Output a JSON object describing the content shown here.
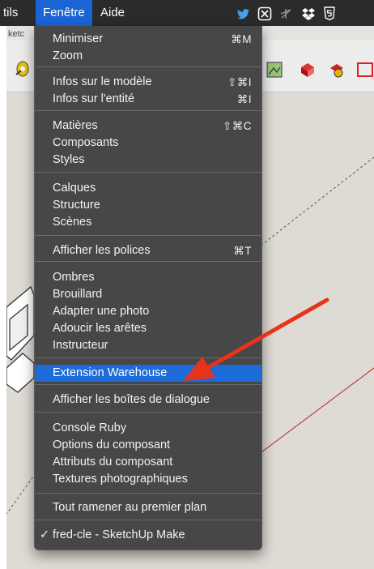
{
  "menubar": {
    "items": [
      "tils",
      "Fenêtre",
      "Aide"
    ],
    "active_index": 1,
    "icons": [
      "twitter-icon",
      "sketchup-extension-icon",
      "wifi-pin-icon",
      "dropbox-icon",
      "html5-icon"
    ]
  },
  "app": {
    "window_title_fragment": "ketc"
  },
  "menu": {
    "sections": [
      [
        {
          "label": "Minimiser",
          "shortcut": "⌘M"
        },
        {
          "label": "Zoom",
          "shortcut": ""
        }
      ],
      [
        {
          "label": "Infos sur le modèle",
          "shortcut": "⇧⌘I"
        },
        {
          "label": "Infos sur l'entité",
          "shortcut": "⌘I"
        }
      ],
      [
        {
          "label": "Matières",
          "shortcut": "⇧⌘C"
        },
        {
          "label": "Composants",
          "shortcut": ""
        },
        {
          "label": "Styles",
          "shortcut": ""
        }
      ],
      [
        {
          "label": "Calques",
          "shortcut": ""
        },
        {
          "label": "Structure",
          "shortcut": ""
        },
        {
          "label": "Scènes",
          "shortcut": ""
        }
      ],
      [
        {
          "label": "Afficher les polices",
          "shortcut": "⌘T"
        }
      ],
      [
        {
          "label": "Ombres",
          "shortcut": ""
        },
        {
          "label": "Brouillard",
          "shortcut": ""
        },
        {
          "label": "Adapter une photo",
          "shortcut": ""
        },
        {
          "label": "Adoucir les arêtes",
          "shortcut": ""
        },
        {
          "label": "Instructeur",
          "shortcut": ""
        }
      ],
      [
        {
          "label": "Extension Warehouse",
          "shortcut": "",
          "highlighted": true
        }
      ],
      [
        {
          "label": "Afficher les boîtes de dialogue",
          "shortcut": ""
        }
      ],
      [
        {
          "label": "Console Ruby",
          "shortcut": ""
        },
        {
          "label": "Options du composant",
          "shortcut": ""
        },
        {
          "label": "Attributs du composant",
          "shortcut": ""
        },
        {
          "label": "Textures photographiques",
          "shortcut": ""
        }
      ],
      [
        {
          "label": "Tout ramener au premier plan",
          "shortcut": ""
        }
      ],
      [
        {
          "label": "fred-cle - SketchUp Make",
          "shortcut": "",
          "checked": true,
          "check_glyph": "✓"
        }
      ]
    ]
  },
  "colors": {
    "menubar_bg": "#2b2b2b",
    "menu_bg": "#474747",
    "highlight": "#1c6bd9",
    "arrow": "#e8331c"
  }
}
